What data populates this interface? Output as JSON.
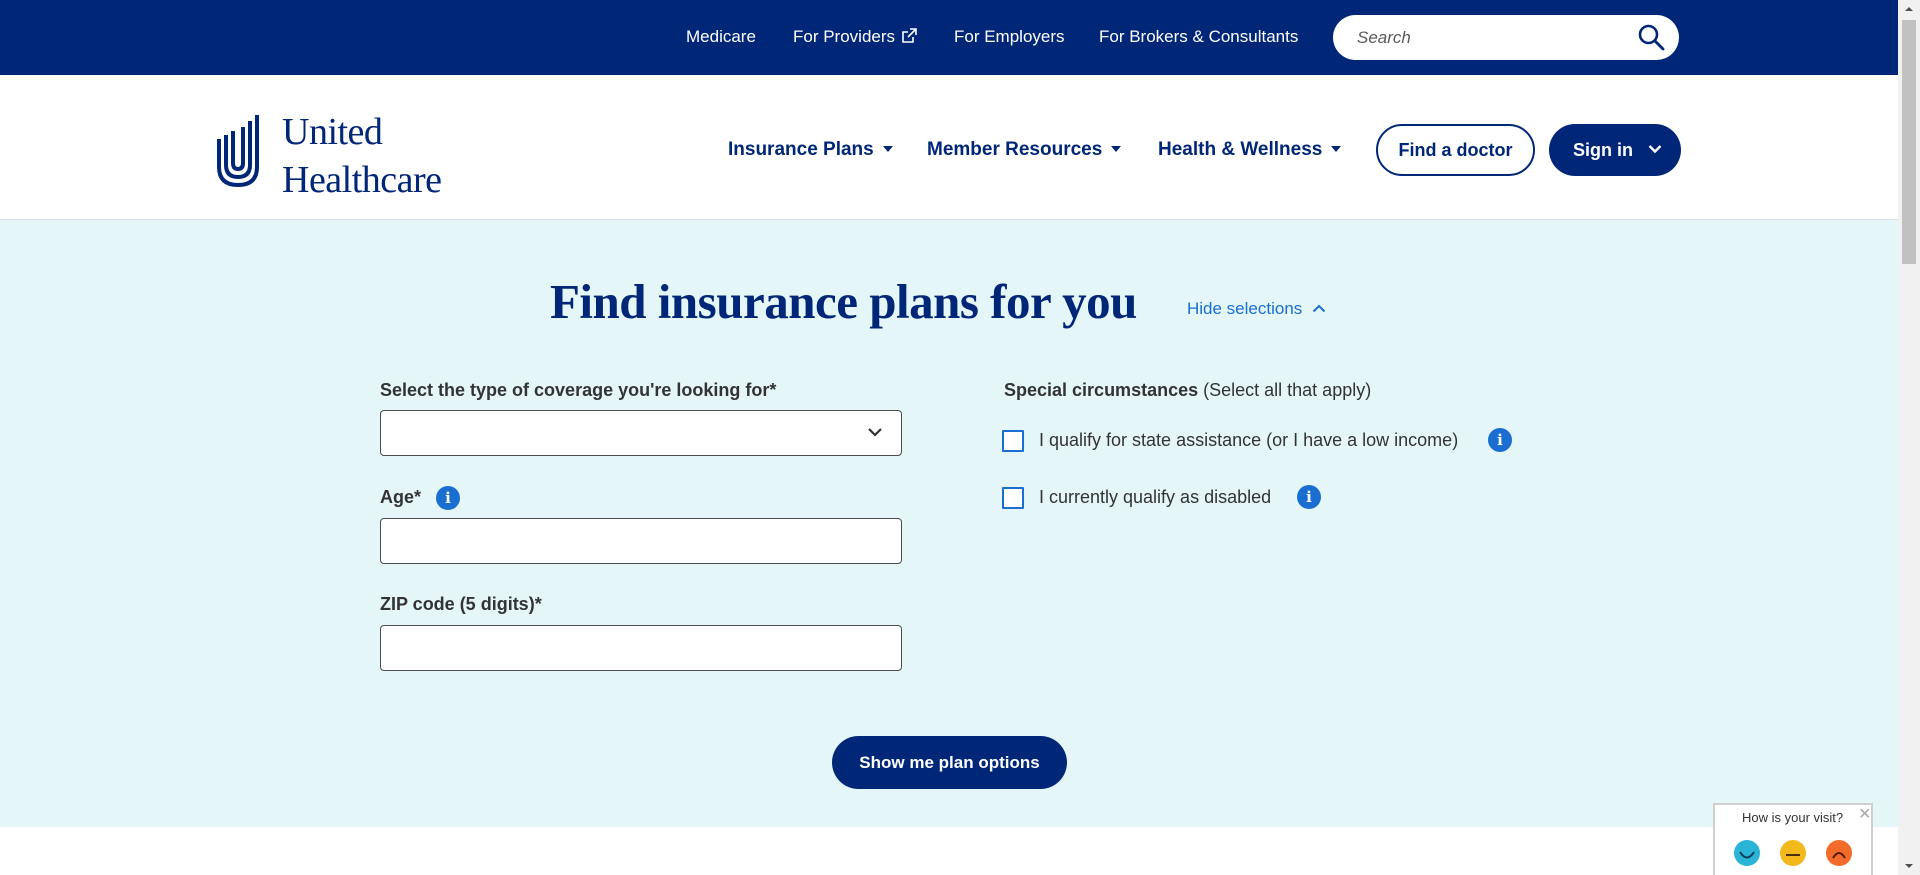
{
  "utility_nav": {
    "links": [
      "Medicare",
      "For Providers",
      "For Employers",
      "For Brokers & Consultants"
    ],
    "search_placeholder": "Search"
  },
  "brand": {
    "line1": "United",
    "line2": "Healthcare"
  },
  "main_nav": {
    "items": [
      "Insurance Plans",
      "Member Resources",
      "Health & Wellness"
    ],
    "find_doctor": "Find a doctor",
    "sign_in": "Sign in"
  },
  "hero": {
    "title": "Find insurance plans for you",
    "toggle": "Hide selections"
  },
  "form": {
    "coverage_label": "Select the type of coverage you're looking for*",
    "coverage_value": "",
    "age_label": "Age*",
    "age_value": "",
    "zip_label": "ZIP code (5 digits)*",
    "zip_value": "",
    "special_title": "Special circumstances",
    "special_hint": "(Select all that apply)",
    "options": [
      {
        "label": "I qualify for state assistance (or I have a low income)",
        "checked": false
      },
      {
        "label": "I currently qualify as disabled",
        "checked": false
      }
    ],
    "submit": "Show me plan options"
  },
  "feedback": {
    "question": "How is your visit?",
    "faces": [
      "happy-face-icon",
      "neutral-face-icon",
      "sad-face-icon"
    ]
  },
  "colors": {
    "navy": "#002677",
    "accent_blue": "#196ecf",
    "hero_bg": "#e5f6f9"
  }
}
